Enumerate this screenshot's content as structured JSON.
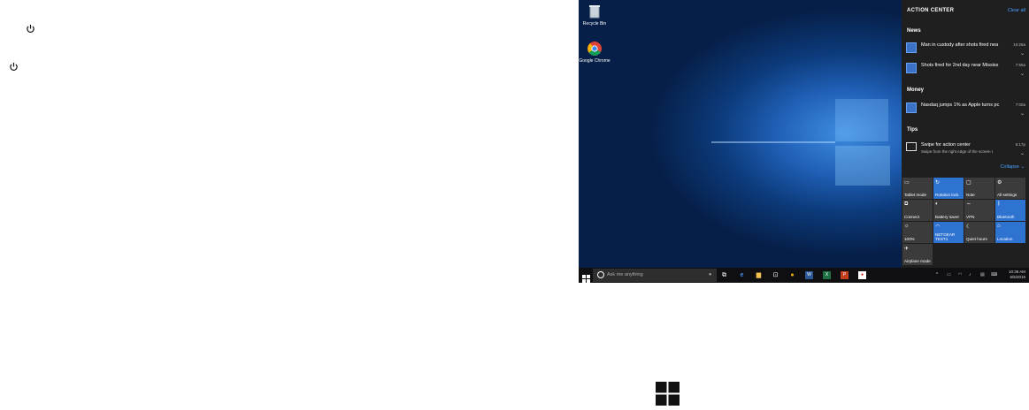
{
  "left_page": {
    "power_icon": "power-icon"
  },
  "desktop": {
    "icons": [
      {
        "label": "Recycle Bin",
        "icon": "recycle-bin-icon"
      },
      {
        "label": "Google Chrome",
        "icon": "chrome-icon"
      }
    ]
  },
  "action_center": {
    "title": "ACTION CENTER",
    "clear_all": "Clear all",
    "sections": [
      {
        "name": "News",
        "items": [
          {
            "text": "Man in custody after shots fired nea",
            "time": "10:26a"
          },
          {
            "text": "Shots fired for 2nd day near Mississ",
            "time": "7:55a"
          }
        ]
      },
      {
        "name": "Money",
        "items": [
          {
            "text": "Nasdaq jumps 1% as Apple turns pc",
            "time": "7:00a"
          }
        ]
      },
      {
        "name": "Tips",
        "items": [
          {
            "text": "Swipe for action center",
            "sub": "Swipe from the right edge of the screen t",
            "time": "5:17p"
          }
        ]
      }
    ],
    "collapse": "Collapse",
    "quick_actions": [
      {
        "label": "Tablet mode",
        "icon": "tablet-mode-icon",
        "on": false
      },
      {
        "label": "Rotation lock",
        "icon": "rotation-lock-icon",
        "on": true
      },
      {
        "label": "Note",
        "icon": "note-icon",
        "on": false
      },
      {
        "label": "All settings",
        "icon": "settings-icon",
        "on": false
      },
      {
        "label": "Connect",
        "icon": "connect-icon",
        "on": false
      },
      {
        "label": "Battery saver",
        "icon": "battery-saver-icon",
        "on": false
      },
      {
        "label": "VPN",
        "icon": "vpn-icon",
        "on": false
      },
      {
        "label": "Bluetooth",
        "icon": "bluetooth-icon",
        "on": true
      },
      {
        "label": "100%",
        "icon": "brightness-icon",
        "on": false
      },
      {
        "label": "NETGEAR TEST1",
        "icon": "wifi-icon",
        "on": true
      },
      {
        "label": "Quiet hours",
        "icon": "moon-icon",
        "on": false
      },
      {
        "label": "Location",
        "icon": "location-icon",
        "on": true
      },
      {
        "label": "Airplane mode",
        "icon": "airplane-icon",
        "on": false
      }
    ]
  },
  "taskbar": {
    "search_placeholder": "Ask me anything",
    "clock_time": "10:36 AM",
    "clock_date": "6/5/2015"
  },
  "colors": {
    "accent": "#2f73d1",
    "action_center_bg": "#1f1f1f",
    "taskbar_bg": "#0f0f12"
  }
}
